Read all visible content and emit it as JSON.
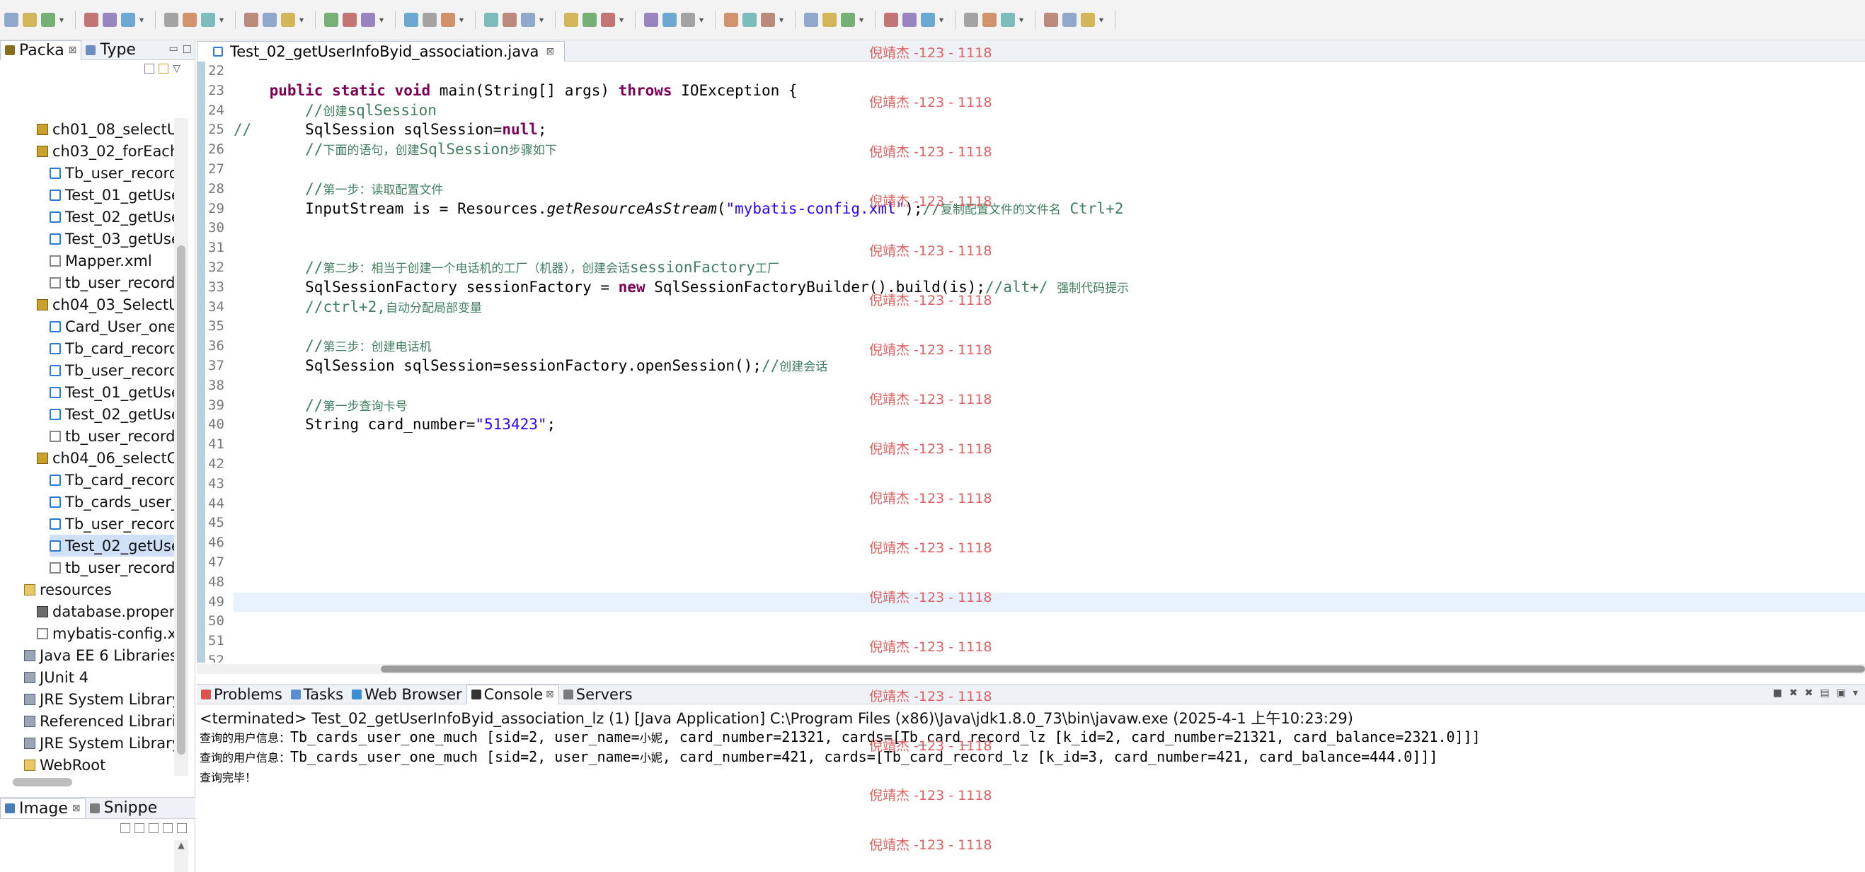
{
  "watermark": "倪靖杰 -123 - 1118",
  "left_pane": {
    "tabs": [
      {
        "label": "Packa"
      },
      {
        "label": "Type"
      }
    ],
    "tree": [
      {
        "label": "ch01_08_selectU",
        "kind": "pkg",
        "indent": 2
      },
      {
        "label": "ch03_02_forEach",
        "kind": "pkg",
        "indent": 2
      },
      {
        "label": "Tb_user_record",
        "kind": "java",
        "indent": 3
      },
      {
        "label": "Test_01_getUse",
        "kind": "java",
        "indent": 3
      },
      {
        "label": "Test_02_getUse",
        "kind": "java",
        "indent": 3
      },
      {
        "label": "Test_03_getUse",
        "kind": "java",
        "indent": 3
      },
      {
        "label": "Mapper.xml",
        "kind": "xml",
        "indent": 3
      },
      {
        "label": "tb_user_record",
        "kind": "xml",
        "indent": 3
      },
      {
        "label": "ch04_03_SelectU",
        "kind": "pkg",
        "indent": 2
      },
      {
        "label": "Card_User_one",
        "kind": "java",
        "indent": 3
      },
      {
        "label": "Tb_card_record",
        "kind": "java",
        "indent": 3
      },
      {
        "label": "Tb_user_record",
        "kind": "java",
        "indent": 3
      },
      {
        "label": "Test_01_getUse",
        "kind": "java",
        "indent": 3
      },
      {
        "label": "Test_02_getUse",
        "kind": "java",
        "indent": 3
      },
      {
        "label": "tb_user_record",
        "kind": "xml",
        "indent": 3
      },
      {
        "label": "ch04_06_selectCa",
        "kind": "pkg",
        "indent": 2
      },
      {
        "label": "Tb_card_record",
        "kind": "java",
        "indent": 3
      },
      {
        "label": "Tb_cards_user_",
        "kind": "java",
        "indent": 3
      },
      {
        "label": "Tb_user_record",
        "kind": "java",
        "indent": 3
      },
      {
        "label": "Test_02_getUse",
        "kind": "java",
        "indent": 3,
        "selected": true
      },
      {
        "label": "tb_user_record",
        "kind": "xml",
        "indent": 3
      },
      {
        "label": "resources",
        "kind": "fold",
        "indent": 1
      },
      {
        "label": "database.propert",
        "kind": "prop",
        "indent": 2
      },
      {
        "label": "mybatis-config.x",
        "kind": "xml",
        "indent": 2
      },
      {
        "label": "Java EE 6 Libraries",
        "kind": "lib",
        "indent": 1
      },
      {
        "label": "JUnit 4",
        "kind": "lib",
        "indent": 1
      },
      {
        "label": "JRE System Library",
        "kind": "lib",
        "indent": 1
      },
      {
        "label": "Referenced Librarie",
        "kind": "lib",
        "indent": 1
      },
      {
        "label": "JRE System Library",
        "kind": "lib",
        "indent": 1
      },
      {
        "label": "WebRoot",
        "kind": "fold",
        "indent": 1
      }
    ],
    "bottom_tabs": [
      {
        "label": "Image"
      },
      {
        "label": "Snippe"
      }
    ]
  },
  "editor": {
    "tab_label": "Test_02_getUserInfoByid_association.java",
    "lines": [
      {
        "no": "22",
        "html": ""
      },
      {
        "no": "23",
        "html": "    <span class=\"kw\">public static void</span> main(String[] args) <span class=\"kw\">throws</span> IOException {"
      },
      {
        "no": "24",
        "html": "        <span class=\"cm\">//<span class=\"cn\">创建</span>sqlSession</span>"
      },
      {
        "no": "25",
        "html": "<span class=\"cm\">//</span>      SqlSession sqlSession=<span class=\"kw\">null</span>;"
      },
      {
        "no": "26",
        "html": "        <span class=\"cm\">//<span class=\"cn\">下面的语句，创建</span>SqlSession<span class=\"cn\">步骤如下</span></span>"
      },
      {
        "no": "27",
        "html": ""
      },
      {
        "no": "28",
        "html": "        <span class=\"cm\">//<span class=\"cn\">第一步：读取配置文件</span></span>"
      },
      {
        "no": "29",
        "html": "        InputStream is = Resources.<span class=\"it\">getResourceAsStream</span>(<span class=\"st\">\"mybatis-config.xml\"</span>);<span class=\"cm\">//<span class=\"cn\">复制配置文件的文件名</span> Ctrl+2</span>"
      },
      {
        "no": "30",
        "html": ""
      },
      {
        "no": "31",
        "html": ""
      },
      {
        "no": "32",
        "html": "        <span class=\"cm\">//<span class=\"cn\">第二步：相当于创建一个电话机的工厂（机器），创建会话</span>sessionFactory<span class=\"cn\">工厂</span></span>"
      },
      {
        "no": "33",
        "html": "        SqlSessionFactory sessionFactory = <span class=\"kw\">new</span> SqlSessionFactoryBuilder().build(is);<span class=\"cm\">//alt+/ <span class=\"cn\">强制代码提示</span></span>"
      },
      {
        "no": "34",
        "html": "        <span class=\"cm\">//ctrl+2,<span class=\"cn\">自动分配局部变量</span></span>"
      },
      {
        "no": "35",
        "html": ""
      },
      {
        "no": "36",
        "html": "        <span class=\"cm\">//<span class=\"cn\">第三步：创建电话机</span></span>"
      },
      {
        "no": "37",
        "html": "        SqlSession sqlSession=sessionFactory.openSession();<span class=\"cm\">//<span class=\"cn\">创建会话</span></span>"
      },
      {
        "no": "38",
        "html": ""
      },
      {
        "no": "39",
        "html": "        <span class=\"cm\">//<span class=\"cn\">第一步查询卡号</span></span>"
      },
      {
        "no": "40",
        "html": "        String card_number=<span class=\"st\">\"513423\"</span>;"
      },
      {
        "no": "41",
        "html": ""
      },
      {
        "no": "42",
        "html": ""
      },
      {
        "no": "43",
        "html": ""
      },
      {
        "no": "44",
        "html": ""
      },
      {
        "no": "45",
        "html": ""
      },
      {
        "no": "46",
        "html": ""
      },
      {
        "no": "47",
        "html": ""
      },
      {
        "no": "48",
        "html": ""
      },
      {
        "no": "49",
        "html": ""
      },
      {
        "no": "50",
        "html": ""
      },
      {
        "no": "51",
        "html": ""
      },
      {
        "no": "52",
        "html": ""
      }
    ]
  },
  "console": {
    "tabs": [
      {
        "label": "Problems",
        "color": "#d9534f"
      },
      {
        "label": "Tasks",
        "color": "#5b8bd0"
      },
      {
        "label": "Web Browser",
        "color": "#3a8fd8"
      },
      {
        "label": "Console",
        "color": "#333333"
      },
      {
        "label": "Servers",
        "color": "#7a7a7a"
      }
    ],
    "status": "<terminated> Test_02_getUserInfoByid_association_lz (1) [Java Application] C:\\Program Files (x86)\\Java\\jdk1.8.0_73\\bin\\javaw.exe (2025-4-1 上午10:23:29)",
    "output": [
      "<span class=\"cn2\">查询的用户信息：</span>Tb_cards_user_one_much [sid=2, user_name=<span class=\"cn2\">小妮</span>, card_number=21321, cards=[Tb_card_record_lz [k_id=2, card_number=21321, card_balance=2321.0]]]",
      "<span class=\"cn2\">查询的用户信息：</span>Tb_cards_user_one_much [sid=2, user_name=<span class=\"cn2\">小妮</span>, card_number=421, cards=[Tb_card_record_lz [k_id=3, card_number=421, card_balance=444.0]]]",
      "<span class=\"cn2\">查询完毕！</span>"
    ]
  }
}
